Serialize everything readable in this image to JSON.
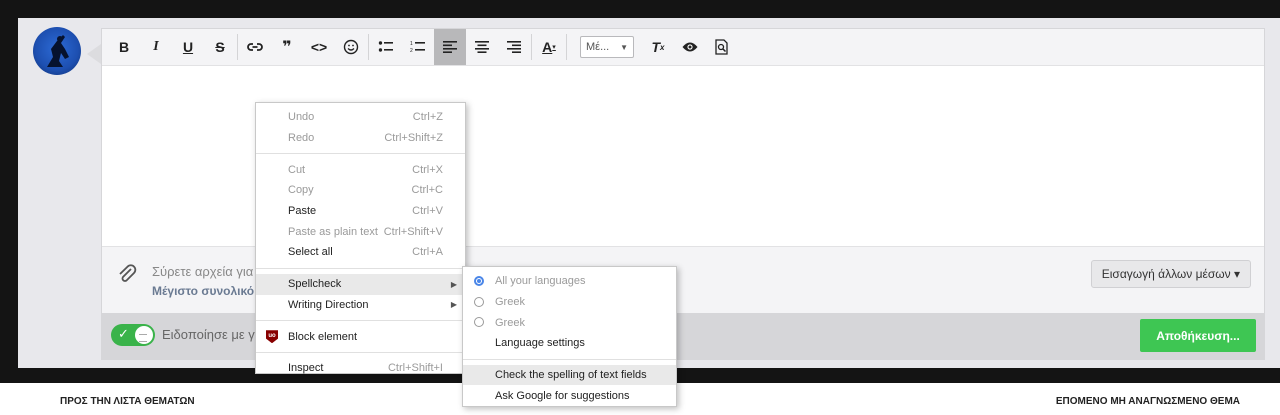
{
  "toolbar": {
    "font_select": "Μέ...",
    "buttons": [
      "bold",
      "italic",
      "underline",
      "strikethrough",
      "link",
      "quote",
      "code",
      "smiley",
      "bullet-list",
      "numbered-list",
      "align-left",
      "align-center",
      "align-right",
      "text-color",
      "font-size",
      "clear-formatting",
      "preview",
      "spellcheck"
    ]
  },
  "attach": {
    "drop_text": "Σύρετε αρχεία για",
    "max_text": "Μέγιστο συνολικό",
    "insert_media": "Εισαγωγή άλλων μέσων ▾"
  },
  "bottom": {
    "notify_text": "Ειδοποίησε με γι",
    "save_label": "Αποθήκευση..."
  },
  "footer": {
    "left": "ΠΡΟΣ ΤΗΝ ΛΙΣΤΑ ΘΕΜΑΤΩΝ",
    "right": "ΕΠΟΜΕΝΟ ΜΗ ΑΝΑΓΝΩΣΜΕΝΟ ΘΕΜΑ"
  },
  "context_menu": {
    "undo": {
      "label": "Undo",
      "shortcut": "Ctrl+Z"
    },
    "redo": {
      "label": "Redo",
      "shortcut": "Ctrl+Shift+Z"
    },
    "cut": {
      "label": "Cut",
      "shortcut": "Ctrl+X"
    },
    "copy": {
      "label": "Copy",
      "shortcut": "Ctrl+C"
    },
    "paste": {
      "label": "Paste",
      "shortcut": "Ctrl+V"
    },
    "paste_plain": {
      "label": "Paste as plain text",
      "shortcut": "Ctrl+Shift+V"
    },
    "select_all": {
      "label": "Select all",
      "shortcut": "Ctrl+A"
    },
    "spellcheck": {
      "label": "Spellcheck"
    },
    "writing_direction": {
      "label": "Writing Direction"
    },
    "block_element": {
      "label": "Block element"
    },
    "inspect": {
      "label": "Inspect",
      "shortcut": "Ctrl+Shift+I"
    }
  },
  "submenu": {
    "all_languages": "All your languages",
    "greek1": "Greek",
    "greek2": "Greek",
    "language_settings": "Language settings",
    "check_spelling": "Check the spelling of text fields",
    "ask_google": "Ask Google for suggestions"
  },
  "colors": {
    "save_green": "#3ec653",
    "toggle_green": "#3ab34a",
    "radio_blue": "#4a86e8"
  }
}
